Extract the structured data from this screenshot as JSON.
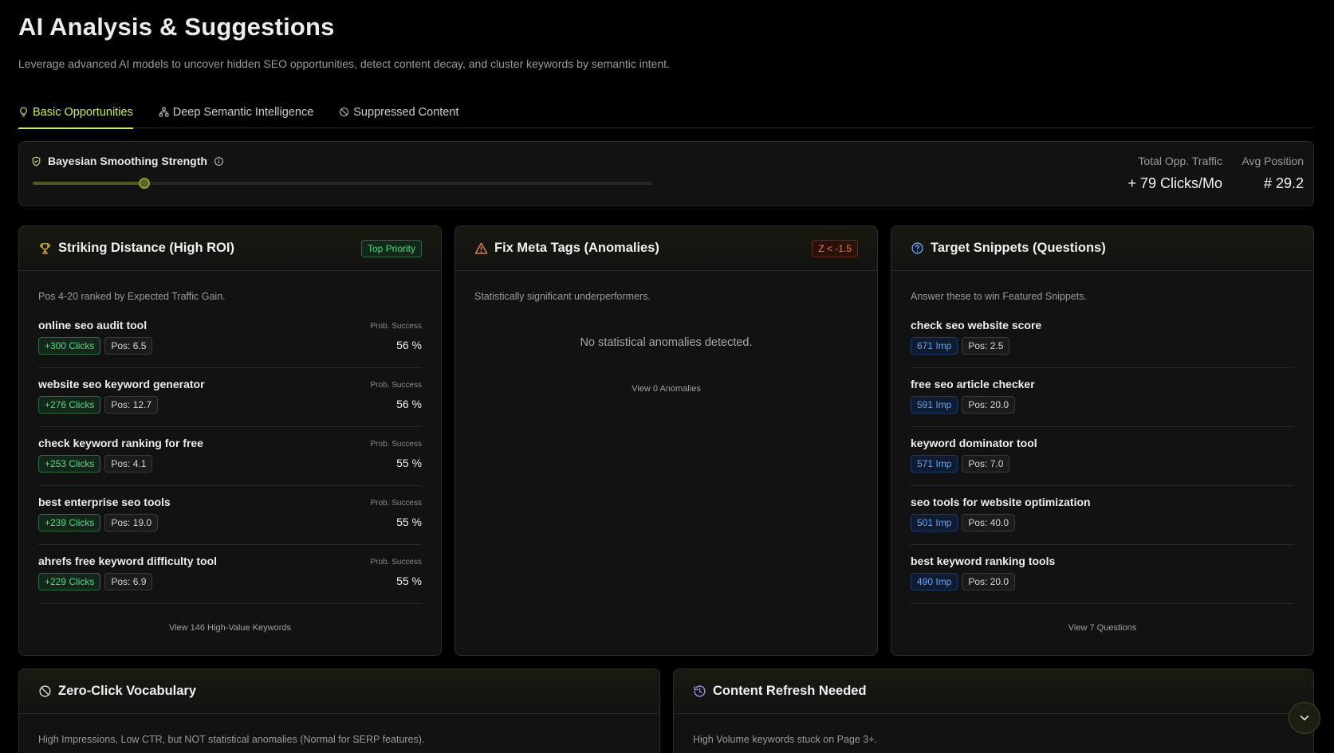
{
  "header": {
    "title": "AI Analysis & Suggestions",
    "subtitle": "Leverage advanced AI models to uncover hidden SEO opportunities, detect content decay, and cluster keywords by semantic intent."
  },
  "tabs": [
    {
      "label": "Basic Opportunities",
      "icon": "lightbulb-icon",
      "active": true
    },
    {
      "label": "Deep Semantic Intelligence",
      "icon": "network-icon",
      "active": false
    },
    {
      "label": "Suppressed Content",
      "icon": "ban-icon",
      "active": false
    }
  ],
  "smoothing": {
    "label": "Bayesian Smoothing Strength",
    "value_fraction": 0.18,
    "stats": {
      "traffic_label": "Total Opp. Traffic",
      "traffic_value": "+ 79 Clicks/Mo",
      "position_label": "Avg Position",
      "position_value": "# 29.2"
    }
  },
  "striking": {
    "title": "Striking Distance (High ROI)",
    "badge": "Top Priority",
    "description": "Pos 4-20 ranked by Expected Traffic Gain.",
    "prob_label": "Prob. Success",
    "items": [
      {
        "keyword": "online seo audit tool",
        "clicks": "+300 Clicks",
        "pos": "Pos: 6.5",
        "prob": "56 %"
      },
      {
        "keyword": "website seo keyword generator",
        "clicks": "+276 Clicks",
        "pos": "Pos: 12.7",
        "prob": "56 %"
      },
      {
        "keyword": "check keyword ranking for free",
        "clicks": "+253 Clicks",
        "pos": "Pos: 4.1",
        "prob": "55 %"
      },
      {
        "keyword": "best enterprise seo tools",
        "clicks": "+239 Clicks",
        "pos": "Pos: 19.0",
        "prob": "55 %"
      },
      {
        "keyword": "ahrefs free keyword difficulty tool",
        "clicks": "+229 Clicks",
        "pos": "Pos: 6.9",
        "prob": "55 %"
      }
    ],
    "link": "View 146 High-Value Keywords"
  },
  "meta": {
    "title": "Fix Meta Tags (Anomalies)",
    "badge": "Z < -1.5",
    "description": "Statistically significant underperformers.",
    "empty": "No statistical anomalies detected.",
    "link": "View 0 Anomalies"
  },
  "snippets": {
    "title": "Target Snippets (Questions)",
    "description": "Answer these to win Featured Snippets.",
    "items": [
      {
        "keyword": "check seo website score",
        "imp": "671 Imp",
        "pos": "Pos: 2.5"
      },
      {
        "keyword": "free seo article checker",
        "imp": "591 Imp",
        "pos": "Pos: 20.0"
      },
      {
        "keyword": "keyword dominator tool",
        "imp": "571 Imp",
        "pos": "Pos: 7.0"
      },
      {
        "keyword": "seo tools for website optimization",
        "imp": "501 Imp",
        "pos": "Pos: 40.0"
      },
      {
        "keyword": "best keyword ranking tools",
        "imp": "490 Imp",
        "pos": "Pos: 20.0"
      }
    ],
    "link": "View 7 Questions"
  },
  "zero_click": {
    "title": "Zero-Click Vocabulary",
    "description": "High Impressions, Low CTR, but NOT statistical anomalies (Normal for SERP features)."
  },
  "refresh": {
    "title": "Content Refresh Needed",
    "description": "High Volume keywords stuck on Page 3+."
  },
  "colors": {
    "accent": "#c8f542",
    "green": "#4ade80",
    "blue": "#60a5fa",
    "red": "#f0794d",
    "purple": "#a78bfa",
    "trophy": "#e0b020"
  },
  "icons": {
    "scroll": "chevron-down-icon"
  }
}
